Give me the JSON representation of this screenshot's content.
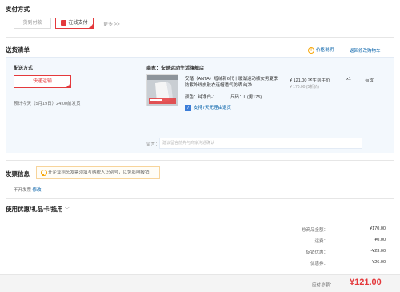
{
  "payment": {
    "title": "支付方式",
    "options": [
      {
        "label": "货到付款",
        "selected": false
      },
      {
        "label": "在线支付",
        "selected": true
      }
    ],
    "more": "更多 >>"
  },
  "delivery": {
    "title": "送货清单",
    "price_note": "价格说明",
    "back_to_cart": "返回修改购物车",
    "method_title": "配送方式",
    "method_selected": "快递运输",
    "estimate": "预计今天（5月19日）24:00前发货",
    "shop": "商家：安踏运动生活旗舰店",
    "product": {
      "name": "安踏（ANTA）增绒新6代丨暖湖运动裤女男夏季防紫外线皮肤衣连帽透气防晒 纯净",
      "price": "¥ 121.00",
      "price_note": "学生到手价",
      "original_price": "¥ 170.00 (5折价)",
      "qty": "x1",
      "stock": "有货",
      "color_label": "颜色：纯净白-1",
      "size_label": "尺码：L (男175)",
      "return_badge": "7",
      "return_text": "支持7天无理由退货"
    },
    "remark_label": "留言：",
    "remark_placeholder": "建议留言前先与商家沟通确认"
  },
  "invoice": {
    "title": "发票信息",
    "tip": "开企业抬头发票须填写纳税人识别号，以免影响报销",
    "status": "不开发票",
    "modify": "修改"
  },
  "coupon": {
    "title": "使用优惠/礼品卡/抵用",
    "chevron": "﹀"
  },
  "summary": {
    "rows": [
      {
        "label": "总商品金额：",
        "value": "¥170.00"
      },
      {
        "label": "运费：",
        "value": "¥0.00"
      },
      {
        "label": "促销优惠：",
        "value": "-¥23.00"
      },
      {
        "label": "优惠券：",
        "value": "-¥26.00"
      }
    ],
    "payable_label": "应付总额：",
    "payable_value": "¥121.00"
  },
  "colors": {
    "accent": "#e4393c",
    "link": "#005ea7",
    "warning": "#f7a70a",
    "panel_bg": "#f3f8fd"
  },
  "icons": [
    "payment-icon",
    "info-icon",
    "return-badge-icon",
    "bulb-icon",
    "chevron-down-icon",
    "check-icon"
  ]
}
